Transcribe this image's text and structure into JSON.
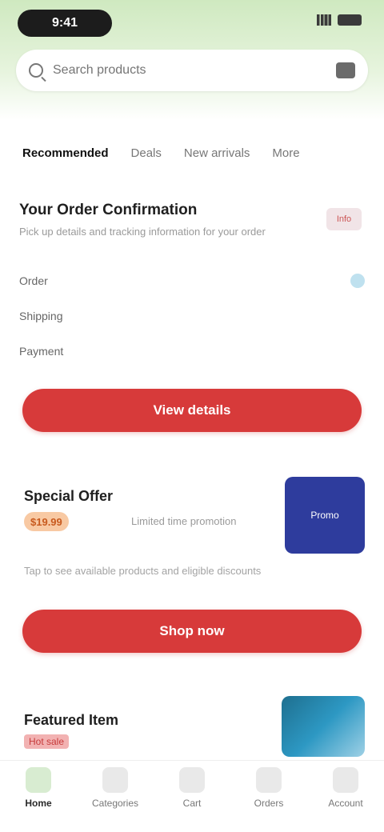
{
  "status_bar": {
    "time": "9:41"
  },
  "search": {
    "placeholder": "Search products"
  },
  "tabs": [
    {
      "label": "Recommended"
    },
    {
      "label": "Deals"
    },
    {
      "label": "New arrivals"
    },
    {
      "label": "More"
    }
  ],
  "card1": {
    "title": "Your Order Confirmation",
    "subtitle": "Pick up details and tracking information for your order",
    "badge": "Info",
    "rows": [
      {
        "label": "Order",
        "value": ""
      },
      {
        "label": "Shipping",
        "value": ""
      },
      {
        "label": "Payment",
        "value": ""
      }
    ],
    "button": "View details"
  },
  "card2": {
    "title": "Special Offer",
    "price": "$19.99",
    "meta": "Limited time promotion",
    "thumb_label": "Promo",
    "description": "Tap to see available products and eligible discounts",
    "button": "Shop now"
  },
  "card3": {
    "title": "Featured Item",
    "tag": "Hot sale"
  },
  "bottom_nav": [
    {
      "label": "Home",
      "icon": "home-icon"
    },
    {
      "label": "Categories",
      "icon": "grid-icon"
    },
    {
      "label": "Cart",
      "icon": "cart-icon"
    },
    {
      "label": "Orders",
      "icon": "receipt-icon"
    },
    {
      "label": "Account",
      "icon": "user-icon"
    }
  ]
}
